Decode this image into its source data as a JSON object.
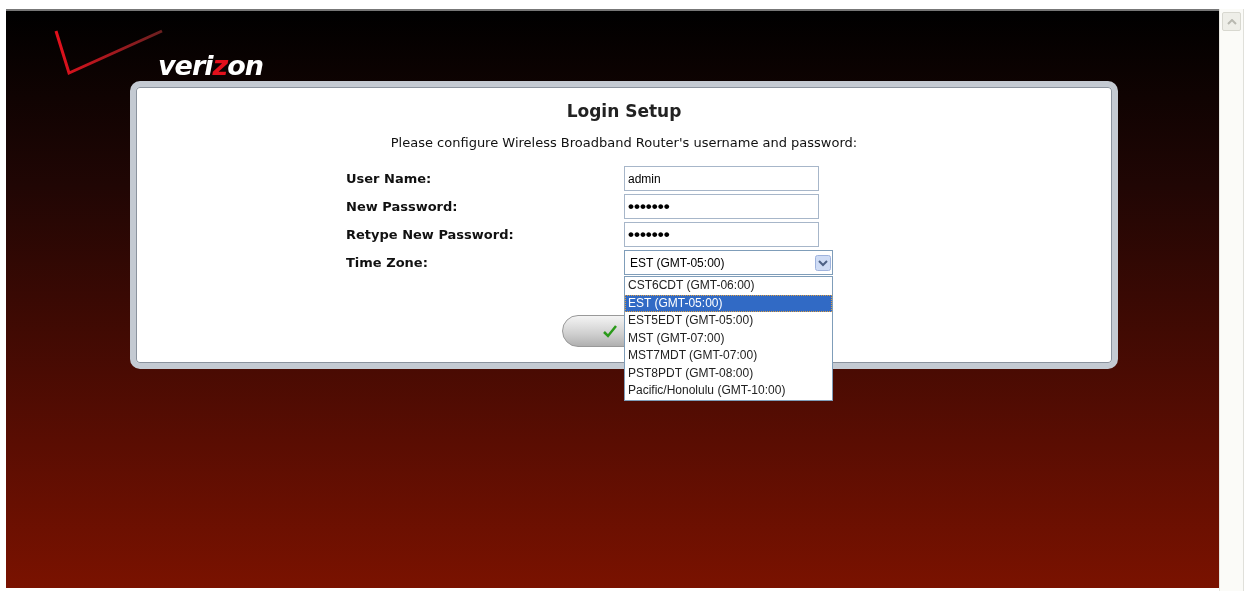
{
  "logo": {
    "parts": [
      {
        "text": "veri",
        "color": "#ffffff"
      },
      {
        "text": "z",
        "color": "#e3101c"
      },
      {
        "text": "on",
        "color": "#ffffff"
      }
    ]
  },
  "form": {
    "title": "Login Setup",
    "instruction": "Please configure Wireless Broadband Router's username and password:",
    "fields": [
      {
        "kind": "text",
        "label": "User Name:",
        "value": "admin"
      },
      {
        "kind": "password",
        "label": "New Password:",
        "value": "•••••••"
      },
      {
        "kind": "password",
        "label": "Retype New Password:",
        "value": "•••••••"
      },
      {
        "kind": "select",
        "label": "Time Zone:",
        "value": "EST (GMT-05:00)",
        "expanded": true,
        "options": [
          {
            "text": "CST6CDT (GMT-06:00)",
            "selected": false
          },
          {
            "text": "EST (GMT-05:00)",
            "selected": true
          },
          {
            "text": "EST5EDT (GMT-05:00)",
            "selected": false
          },
          {
            "text": "MST (GMT-07:00)",
            "selected": false
          },
          {
            "text": "MST7MDT (GMT-07:00)",
            "selected": false
          },
          {
            "text": "PST8PDT (GMT-08:00)",
            "selected": false
          },
          {
            "text": "Pacific/Honolulu (GMT-10:00)",
            "selected": false
          }
        ]
      }
    ]
  }
}
